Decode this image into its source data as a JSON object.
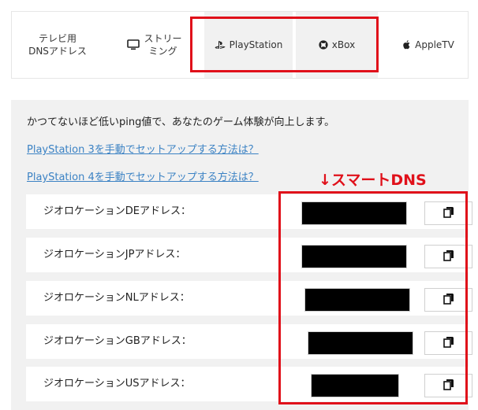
{
  "tabs": [
    {
      "label": "テレビ用\nDNSアドレス",
      "icon": "",
      "active": false
    },
    {
      "label": "ストリー\nミング",
      "icon": "monitor-icon",
      "active": false
    },
    {
      "label": "PlayStation",
      "icon": "playstation-icon",
      "active": true
    },
    {
      "label": "xBox",
      "icon": "xbox-icon",
      "active": false
    },
    {
      "label": "AppleTV",
      "icon": "apple-icon",
      "active": false
    }
  ],
  "panel": {
    "description": "かつてないほど低いping値で、あなたのゲーム体験が向上します。",
    "link_ps3": "PlayStation 3を手動でセットアップする方法は？",
    "link_ps4": "PlayStation 4を手動でセットアップする方法は？"
  },
  "annotation": {
    "smart_dns": "↓スマートDNS"
  },
  "rows": [
    {
      "label": "ジオロケーションDEアドレス："
    },
    {
      "label": "ジオロケーションJPアドレス："
    },
    {
      "label": "ジオロケーションNLアドレス："
    },
    {
      "label": "ジオロケーションGBアドレス："
    },
    {
      "label": "ジオロケーションUSアドレス："
    }
  ],
  "colors": {
    "highlight": "#e0101a",
    "link": "#3b82c4",
    "panel_bg": "#f1f1f1"
  }
}
